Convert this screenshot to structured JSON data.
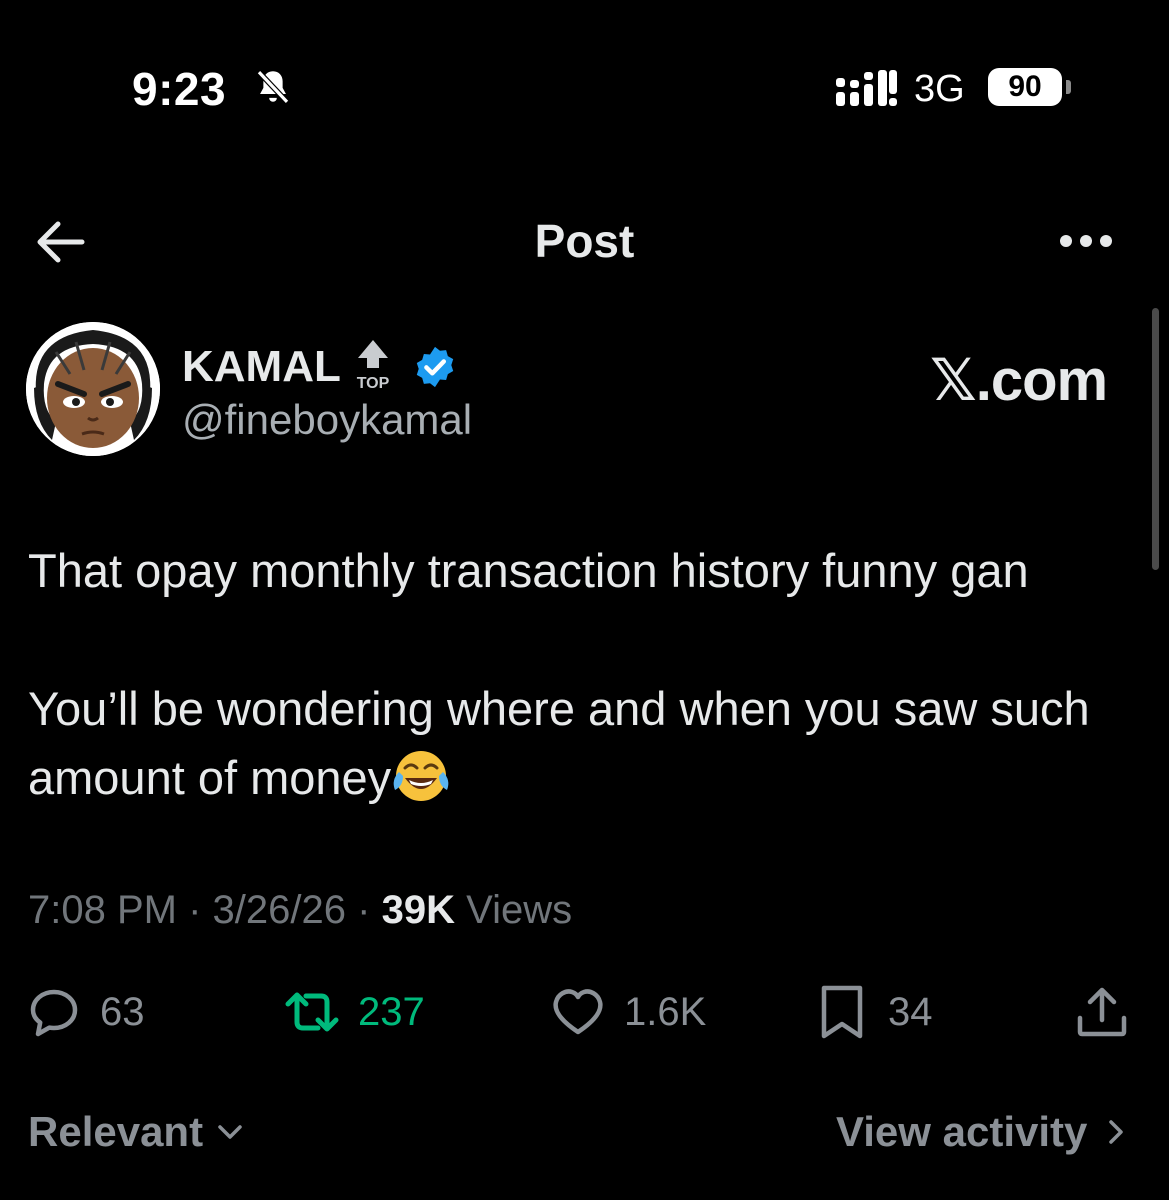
{
  "status_bar": {
    "time": "9:23",
    "network": "3G",
    "battery": "90"
  },
  "header": {
    "title": "Post",
    "back_icon": "arrow-left-icon",
    "more_icon": "more-horizontal-icon"
  },
  "author": {
    "display_name": "KAMAL",
    "top_badge": "TOP",
    "handle": "@fineboykamal",
    "verified": true
  },
  "watermark": "𝕏.com",
  "post": {
    "paragraph_1": "That opay monthly transaction history funny gan",
    "paragraph_2": "You’ll be wondering where and when you saw such amount of money",
    "emoji": "face-with-tears-of-joy"
  },
  "meta": {
    "time": "7:08 PM",
    "date": "3/26/26",
    "views_count": "39K",
    "views_label": "Views",
    "separator": "·"
  },
  "actions": {
    "replies": "63",
    "reposts": "237",
    "likes": "1.6K",
    "bookmarks": "34"
  },
  "footer": {
    "sort_label": "Relevant",
    "view_activity": "View activity"
  },
  "colors": {
    "background": "#000000",
    "text": "#e7e9ea",
    "muted": "#71767b",
    "repost_active": "#00ba7c",
    "verified": "#1d9bf0"
  }
}
